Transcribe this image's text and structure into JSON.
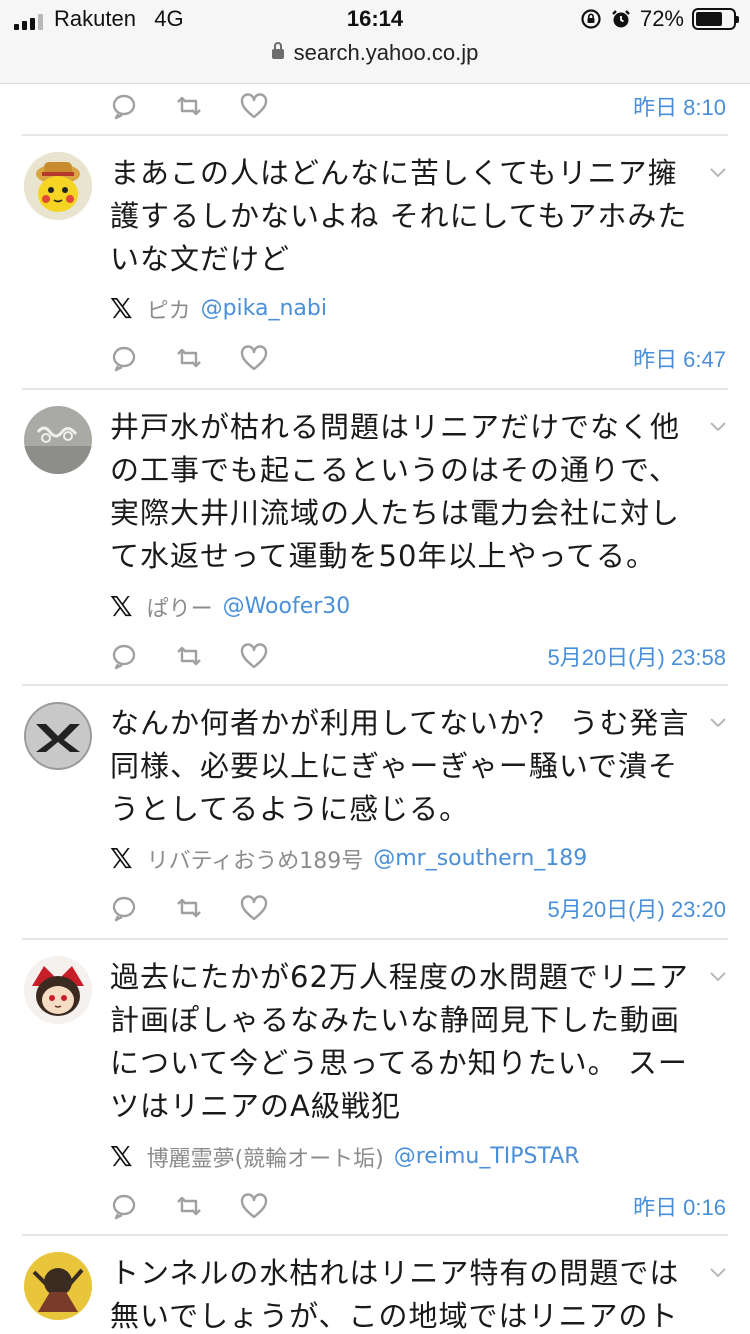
{
  "status_bar": {
    "carrier": "Rakuten",
    "network": "4G",
    "time": "16:14",
    "battery": "72%",
    "battery_level": 0.72
  },
  "url_bar": {
    "url": "search.yahoo.co.jp"
  },
  "first_timestamp": "昨日 8:10",
  "posts": [
    {
      "text": "まあこの人はどんなに苦しくてもリニア擁護するしかないよね それにしてもアホみたいな文だけど",
      "name": "ピカ",
      "handle": "@pika_nabi",
      "time": "昨日 6:47"
    },
    {
      "text": "井戸水が枯れる問題はリニアだけでなく他の工事でも起こるというのはその通りで、実際大井川流域の人たちは電力会社に対して水返せって運動を50年以上やってる。",
      "name": "ぱりー",
      "handle": "@Woofer30",
      "time": "5月20日(月) 23:58"
    },
    {
      "text": "なんか何者かが利用してないか？ うむ発言同様、必要以上にぎゃーぎゃー騒いで潰そうとしてるように感じる。",
      "name": "リバティおうめ189号",
      "handle": "@mr_southern_189",
      "time": "5月20日(月) 23:20"
    },
    {
      "text": "過去にたかが62万人程度の水問題でリニア計画ぽしゃるなみたいな静岡見下した動画について今どう思ってるか知りたい。 スーツはリニアのA級戦犯",
      "name": "博麗霊夢(競輪オート垢)",
      "handle": "@reimu_TIPSTAR",
      "time": "昨日 0:16"
    },
    {
      "text": "トンネルの水枯れはリニア特有の問題では無いでしょうが、この地域ではリニアのト"
    }
  ],
  "x_glyph": "𝕏",
  "colors": {
    "link": "#4a8fd8",
    "muted": "#8c8c8c",
    "icon": "#9a9a9a"
  }
}
